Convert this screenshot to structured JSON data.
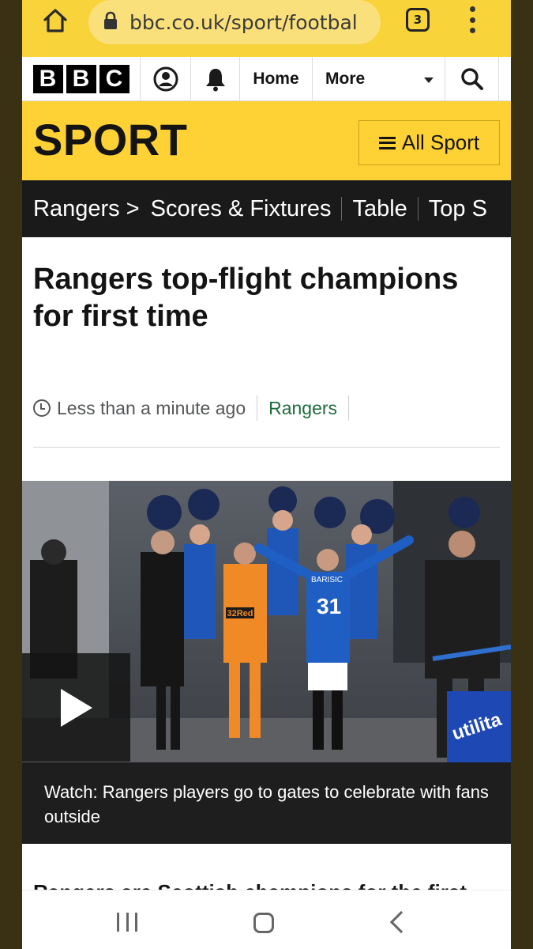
{
  "browser": {
    "url": "bbc.co.uk/sport/footbal",
    "tab_count": "3",
    "home_icon": "home-icon",
    "lock_icon": "lock-icon",
    "menu_icon": "kebab-menu-icon"
  },
  "bbc_nav": {
    "logo_letters": [
      "B",
      "B",
      "C"
    ],
    "home_label": "Home",
    "more_label": "More",
    "account_icon": "account-icon",
    "notification_icon": "bell-icon",
    "search_icon": "search-icon"
  },
  "sport_header": {
    "title": "SPORT",
    "all_sport_label": "All Sport"
  },
  "section_nav": {
    "team": "Rangers >",
    "items": [
      "Scores & Fixtures",
      "Table",
      "Top S"
    ]
  },
  "article": {
    "headline": "Rangers top-flight champions for first time",
    "timestamp": "Less than a minute ago",
    "tag": "Rangers",
    "media_caption": "Watch: Rangers players go to gates to celebrate with fans outside",
    "body_start": "Rangers are Scottish champions for the first"
  },
  "photo_text": {
    "sponsor": "32Red",
    "shirt_number": "31",
    "shirt_name": "BARISIC",
    "board": "utilita"
  },
  "colors": {
    "browser_bar": "#f8d33a",
    "sport_yellow": "#fed134",
    "section_nav": "#1a1a1a",
    "tag_green": "#1d6b3c"
  }
}
